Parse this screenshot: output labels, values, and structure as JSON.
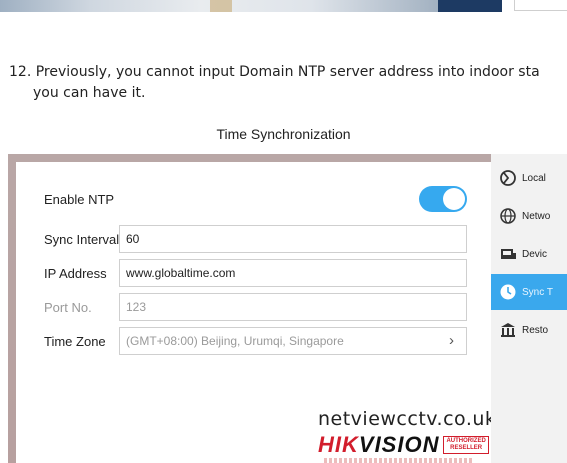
{
  "step": {
    "line1": "12. Previously, you cannot input Domain NTP server address into indoor sta",
    "line2": "you can have it."
  },
  "caption": "Time Synchronization",
  "dialog": {
    "enable_ntp": {
      "label": "Enable NTP",
      "on": true
    },
    "sync_interval": {
      "label": "Sync Interval",
      "value": "60"
    },
    "ip_address": {
      "label": "IP Address",
      "value": "www.globaltime.com"
    },
    "port_no": {
      "label": "Port No.",
      "value": "123"
    },
    "time_zone": {
      "label": "Time Zone",
      "value": "(GMT+08:00) Beijing, Urumqi, Singapore"
    }
  },
  "watermark": {
    "site": "netviewcctv.co.uk",
    "brand_hik": "HIK",
    "brand_vision": "VISION",
    "badge": "AUTHORIZED RESELLER"
  },
  "menu": {
    "items": [
      {
        "label": "Local",
        "icon": "local-icon",
        "active": false
      },
      {
        "label": "Netwo",
        "icon": "globe-icon",
        "active": false
      },
      {
        "label": "Devic",
        "icon": "device-icon",
        "active": false
      },
      {
        "label": "Sync T",
        "icon": "clock-icon",
        "active": true
      },
      {
        "label": "Resto",
        "icon": "restore-icon",
        "active": false
      }
    ]
  },
  "colors": {
    "accent": "#36a9ef",
    "brand_red": "#d21d2c",
    "device_bg": "#b9a7a6"
  }
}
